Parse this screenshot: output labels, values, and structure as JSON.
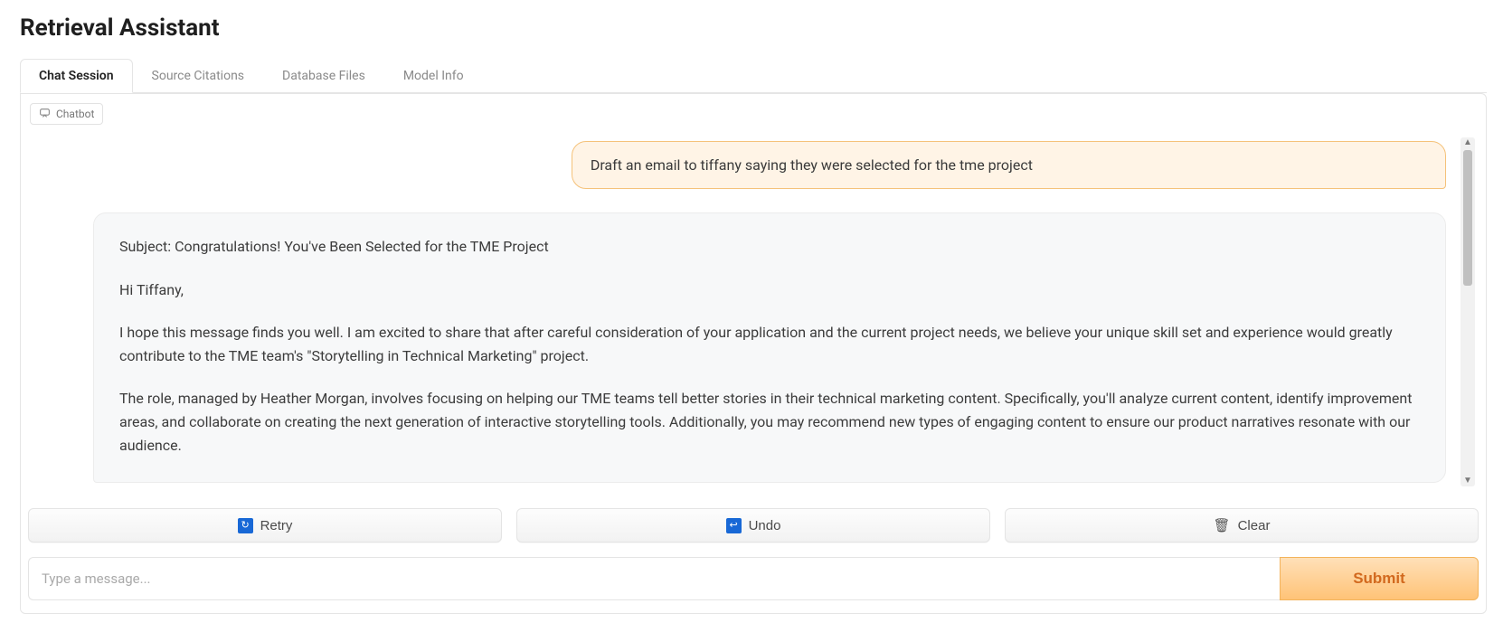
{
  "page_title": "Retrieval Assistant",
  "tabs": [
    {
      "label": "Chat Session",
      "active": true
    },
    {
      "label": "Source Citations",
      "active": false
    },
    {
      "label": "Database Files",
      "active": false
    },
    {
      "label": "Model Info",
      "active": false
    }
  ],
  "chatbot_tag": "Chatbot",
  "chat": {
    "user_message": "Draft an email to tiffany saying they were selected for the tme project",
    "bot_message": {
      "subject_line": "Subject: Congratulations! You've Been Selected for the TME Project",
      "greeting": "Hi Tiffany,",
      "para1": "I hope this message finds you well. I am excited to share that after careful consideration of your application and the current project needs, we believe your unique skill set and experience would greatly contribute to the TME team's \"Storytelling in Technical Marketing\" project.",
      "para2": "The role, managed by Heather Morgan, involves focusing on helping our TME teams tell better stories in their technical marketing content. Specifically, you'll analyze current content, identify improvement areas, and collaborate on creating the next generation of interactive storytelling tools. Additionally, you may recommend new types of engaging content to ensure our product narratives resonate with our audience."
    }
  },
  "actions": {
    "retry": "Retry",
    "undo": "Undo",
    "clear": "Clear"
  },
  "input": {
    "placeholder": "Type a message...",
    "value": "",
    "submit_label": "Submit"
  },
  "icons": {
    "chat": "chat-icon",
    "retry": "retry-icon",
    "undo": "undo-icon",
    "clear": "trash-icon"
  },
  "colors": {
    "accent": "#e67e22",
    "user_bubble_bg": "#fff4e6",
    "user_bubble_border": "#f5c27a",
    "bot_bubble_bg": "#f7f8f9"
  }
}
